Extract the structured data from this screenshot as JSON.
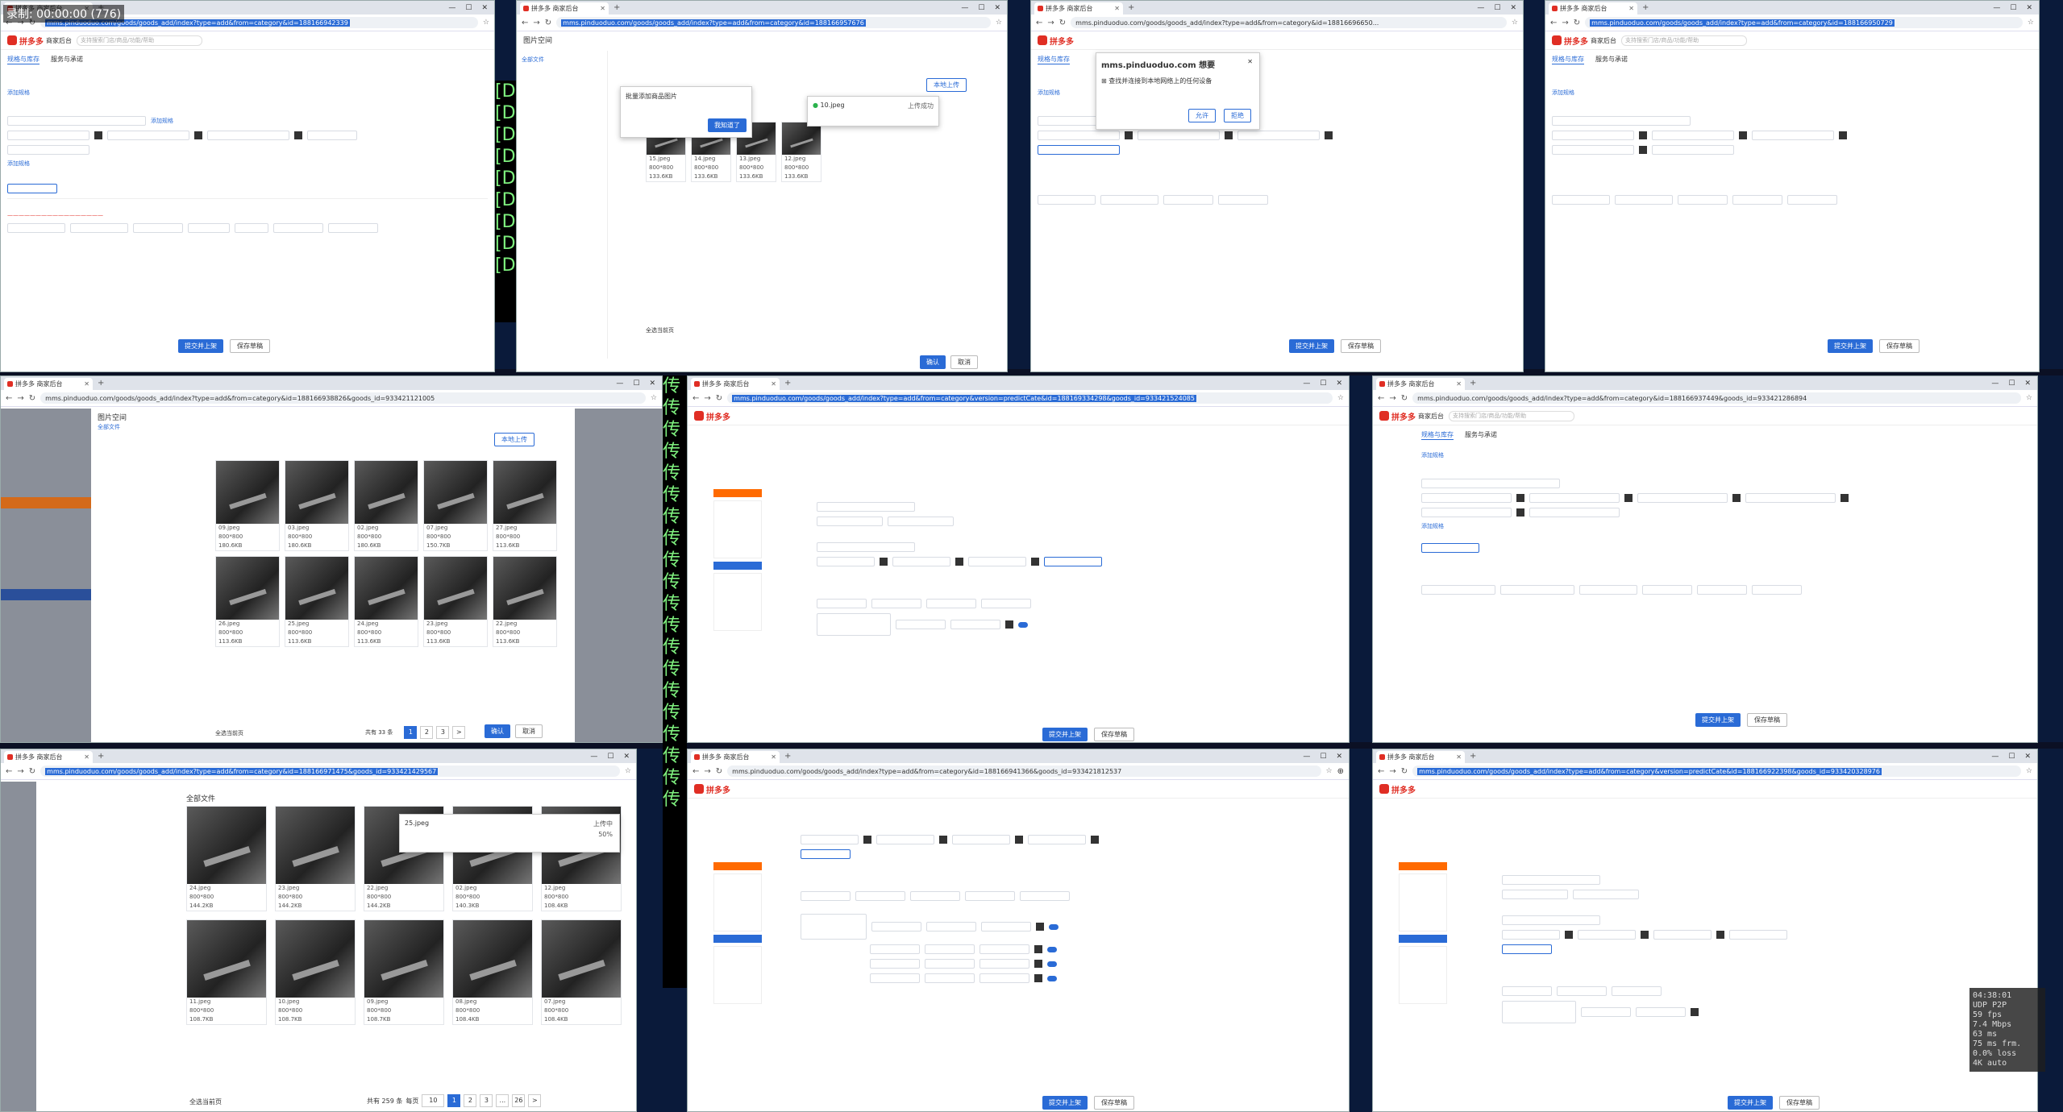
{
  "recording_overlay": "录制: 00:00:00 (776)",
  "stats": [
    "04:38:01",
    "UDP P2P",
    "59 fps",
    "7.4 Mbps",
    "63 ms",
    "75 ms frm.",
    "0.0% loss",
    "4K auto"
  ],
  "terminal_chars": [
    "[D",
    "[D",
    "[D",
    "[D",
    "[D",
    "[D",
    "[D",
    "[D",
    "[D"
  ],
  "terminal_chars2": [
    "传",
    "传",
    "传",
    "传",
    "传",
    "传",
    "传",
    "传",
    "传",
    "传",
    "传",
    "传",
    "传",
    "传",
    "传",
    "传",
    "传",
    "传",
    "传",
    "传"
  ],
  "common": {
    "tab_title": "拼多多 商家后台",
    "logo": "拼多多",
    "logo_sub": "商家后台",
    "search_placeholder": "支持搜索门店/商品/功能/帮助",
    "submit": "提交并上架",
    "save_draft": "保存草稿",
    "add_spec": "添加规格",
    "tab_specs": "规格与库存",
    "tab_service": "服务与承诺"
  },
  "windows": [
    {
      "url": "mms.pinduoduo.com/goods/goods_add/index?type=add&from=category&id=188166942339"
    },
    {
      "url": "mms.pinduoduo.com/goods/goods_add/index?type=add&from=category&id=188166957676"
    },
    {
      "url": "mms.pinduoduo.com/goods/goods_add/index?type=add&from=category&id=18816696650..."
    },
    {
      "url": "mms.pinduoduo.com/goods/goods_add/index?type=add&from=category&id=188166950729"
    },
    {
      "url": "mms.pinduoduo.com/goods/goods_add/index?type=add&from=category&id=188166938826&goods_id=933421121005"
    },
    {
      "url": "mms.pinduoduo.com/goods/goods_add/index?type=add&from=category&version=predictCate&id=188169334298&goods_id=933421524085"
    },
    {
      "url": "mms.pinduoduo.com/goods/goods_add/index?type=add&from=category&id=188166937449&goods_id=933421286894"
    },
    {
      "url": "mms.pinduoduo.com/goods/goods_add/index?type=add&from=category&id=188166971475&goods_id=933421429567"
    },
    {
      "url": "mms.pinduoduo.com/goods/goods_add/index?type=add&from=category&id=188166941366&goods_id=933421812537"
    },
    {
      "url": "mms.pinduoduo.com/goods/goods_add/index?type=add&from=category&version=predictCate&id=188166922398&goods_id=933420328976"
    }
  ],
  "dialog_permission": {
    "title": "mms.pinduoduo.com 想要",
    "text": "查找并连接到本地网络上的任何设备",
    "allow": "允许",
    "block": "拒绝"
  },
  "picspace": {
    "title": "图片空间",
    "upload_btn": "本地上传",
    "all_files": "全部文件",
    "confirm": "确认",
    "cancel": "取消",
    "select_all": "全选当前页",
    "upload_popup_title": "批量添加商品图片",
    "upload_popup_btn": "我知道了",
    "uploading_file": "10.jpeg",
    "uploading_status": "上传成功",
    "w5_total": "共有 33 条",
    "pages_w5": [
      "1",
      "2",
      "3",
      ">"
    ],
    "thumbs_w2": [
      {
        "name": "15.jpeg",
        "dim": "800*800",
        "size": "133.6KB"
      },
      {
        "name": "14.jpeg",
        "dim": "800*800",
        "size": "133.6KB"
      },
      {
        "name": "13.jpeg",
        "dim": "800*800",
        "size": "133.6KB"
      },
      {
        "name": "12.jpeg",
        "dim": "800*800",
        "size": "133.6KB"
      }
    ],
    "thumbs_w5": [
      {
        "name": "09.jpeg",
        "dim": "800*800",
        "size": "180.6KB"
      },
      {
        "name": "03.jpeg",
        "dim": "800*800",
        "size": "180.6KB"
      },
      {
        "name": "02.jpeg",
        "dim": "800*800",
        "size": "180.6KB"
      },
      {
        "name": "07.jpeg",
        "dim": "800*800",
        "size": "150.7KB"
      },
      {
        "name": "27.jpeg",
        "dim": "800*800",
        "size": "113.6KB"
      },
      {
        "name": "26.jpeg",
        "dim": "800*800",
        "size": "113.6KB"
      },
      {
        "name": "25.jpeg",
        "dim": "800*800",
        "size": "113.6KB"
      },
      {
        "name": "24.jpeg",
        "dim": "800*800",
        "size": "113.6KB"
      },
      {
        "name": "23.jpeg",
        "dim": "800*800",
        "size": "113.6KB"
      },
      {
        "name": "22.jpeg",
        "dim": "800*800",
        "size": "113.6KB"
      }
    ],
    "thumbs_w8": [
      {
        "name": "24.jpeg",
        "dim": "800*800",
        "size": "144.2KB"
      },
      {
        "name": "23.jpeg",
        "dim": "800*800",
        "size": "144.2KB"
      },
      {
        "name": "22.jpeg",
        "dim": "800*800",
        "size": "144.2KB"
      },
      {
        "name": "02.jpeg",
        "dim": "800*800",
        "size": "140.3KB"
      },
      {
        "name": "12.jpeg",
        "dim": "800*800",
        "size": "108.4KB"
      },
      {
        "name": "11.jpeg",
        "dim": "800*800",
        "size": "108.7KB"
      },
      {
        "name": "10.jpeg",
        "dim": "800*800",
        "size": "108.7KB"
      },
      {
        "name": "09.jpeg",
        "dim": "800*800",
        "size": "108.7KB"
      },
      {
        "name": "08.jpeg",
        "dim": "800*800",
        "size": "108.4KB"
      },
      {
        "name": "07.jpeg",
        "dim": "800*800",
        "size": "108.4KB"
      }
    ],
    "w8_upload_file": "25.jpeg",
    "w8_upload_status": "上传中",
    "w8_upload_pct": "50%",
    "w8_total": "共有 259 条",
    "w8_perpage": "每页",
    "w8_perpage_val": "10",
    "w8_pages": [
      "1",
      "2",
      "3",
      "...",
      "26",
      ">"
    ]
  }
}
